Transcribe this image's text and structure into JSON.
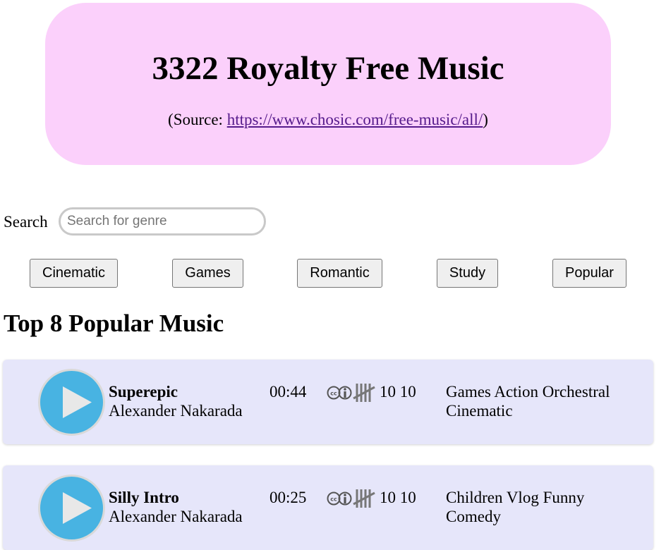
{
  "header": {
    "title": "3322 Royalty Free Music",
    "source_prefix": "(Source: ",
    "source_link": "https://www.chosic.com/free-music/all/",
    "source_suffix": ")"
  },
  "search": {
    "label": "Search",
    "placeholder": "Search for genre",
    "value": ""
  },
  "genres": [
    "Cinematic",
    "Games",
    "Romantic",
    "Study",
    "Popular"
  ],
  "section_title": "Top 8 Popular Music",
  "tracks": [
    {
      "title": "Superepic",
      "artist": "Alexander Nakarada",
      "duration": "00:44",
      "license_icon": "creative-commons-by-icon",
      "count_icon": "tally-marks-icon",
      "counts": "10 10",
      "tags": "Games Action Orchestral Cinematic"
    },
    {
      "title": "Silly Intro",
      "artist": "Alexander Nakarada",
      "duration": "00:25",
      "license_icon": "creative-commons-by-icon",
      "count_icon": "tally-marks-icon",
      "counts": "10 10",
      "tags": "Children Vlog Funny Comedy"
    }
  ],
  "colors": {
    "hero_bg": "#fbd0fb",
    "card_bg": "#e6e6fa",
    "play_button": "#48b3e2",
    "link": "#551a8b"
  }
}
